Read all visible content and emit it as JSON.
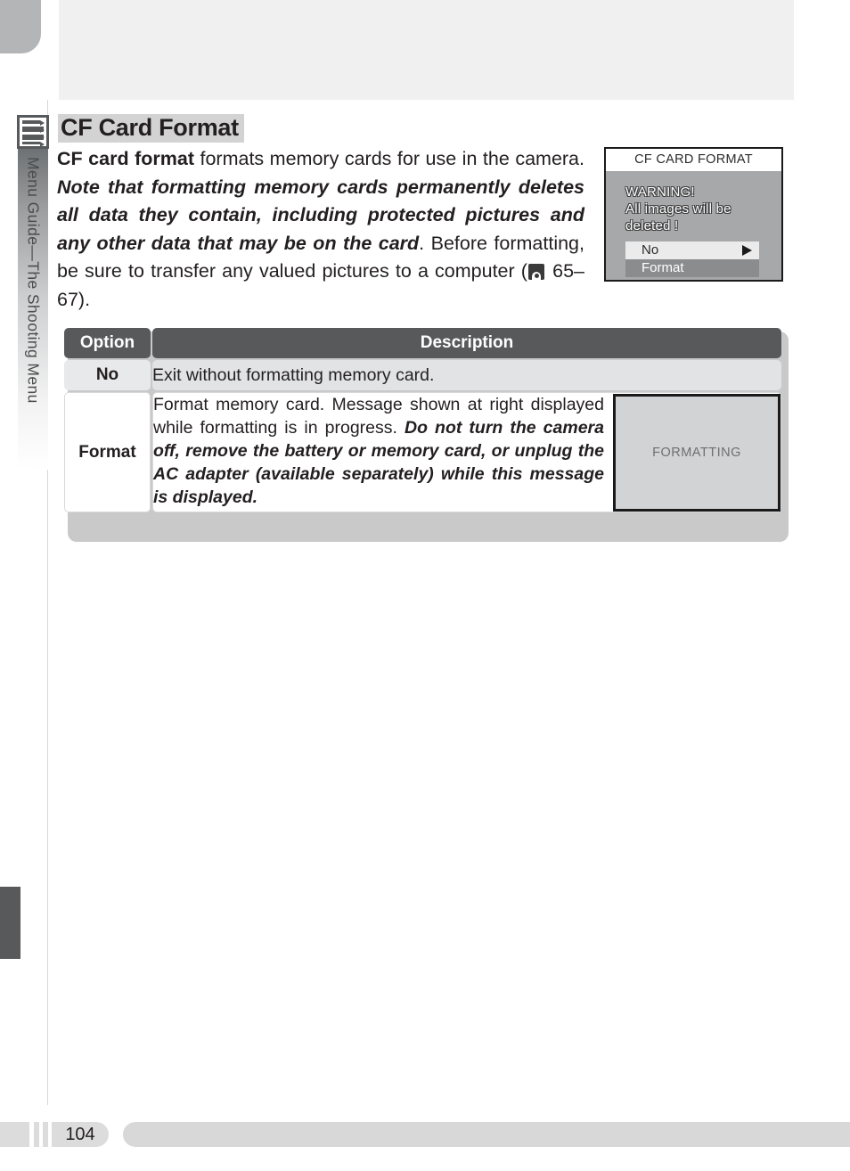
{
  "sidebar": {
    "icon": "menu-list-icon",
    "label": "Menu Guide—The Shooting Menu"
  },
  "page": {
    "title": "CF Card Format",
    "number": "104"
  },
  "intro": {
    "lead": "CF card format",
    "text_1": " formats memory cards for use in the camera.  ",
    "emphasis": "Note that formatting memory cards permanently deletes all data they contain, including protected pictures and any other data that may be on the card",
    "text_2": ".  Before formatting, be sure to transfer any valued pictures to a computer (",
    "page_ref_icon": "camera-page-reference-icon",
    "page_ref": " 65–67)."
  },
  "lcd_dialog": {
    "title": "CF CARD FORMAT",
    "warning_line_1": "WARNING!",
    "warning_line_2": "All images will be",
    "warning_line_3": "deleted !",
    "option_selected": "No",
    "option_unselected": "Format",
    "arrow_icon": "right-arrow-icon"
  },
  "table": {
    "headers": [
      "Option",
      "Description"
    ],
    "rows": [
      {
        "option": "No",
        "description": "Exit without formatting memory card.",
        "has_lcd": false
      },
      {
        "option": "Format",
        "description_plain_1": "Format memory card.  Message shown at right displayed while formatting is in progress.  ",
        "description_italic": "Do not turn the camera off, remove the battery or memory card, or unplug the AC adapter (available separately) while this message is displayed.",
        "has_lcd": true,
        "lcd_label": "FORMATTING"
      }
    ]
  },
  "colors": {
    "header_dark": "#58595b",
    "row_shaded": "#e8e9ea",
    "lcd_background": "#a6a8aa",
    "lcd2_background": "#d2d3d4",
    "title_highlight": "#d3d3d3"
  }
}
